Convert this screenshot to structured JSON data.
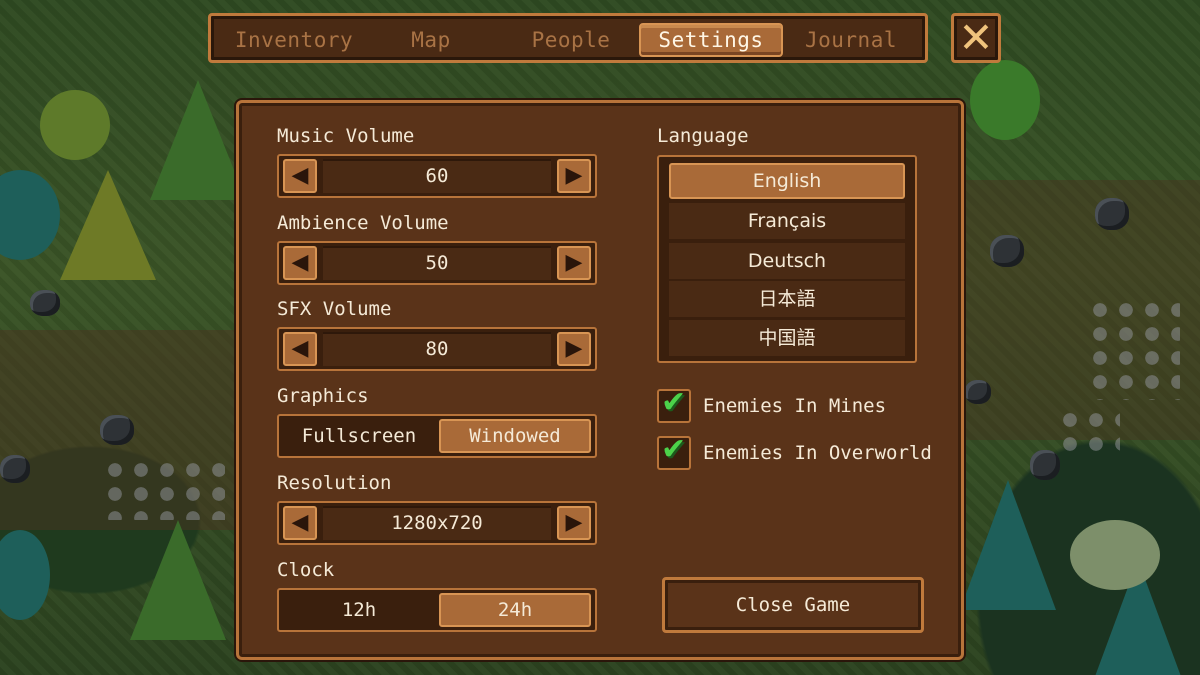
{
  "tabs": [
    {
      "label": "Inventory"
    },
    {
      "label": "Map"
    },
    {
      "label": "People"
    },
    {
      "label": "Settings",
      "active": true
    },
    {
      "label": "Journal"
    }
  ],
  "close_icon": "close-x-icon",
  "settings": {
    "music": {
      "label": "Music Volume",
      "value": "60"
    },
    "ambience": {
      "label": "Ambience Volume",
      "value": "50"
    },
    "sfx": {
      "label": "SFX Volume",
      "value": "80"
    },
    "graphics": {
      "label": "Graphics",
      "options": [
        "Fullscreen",
        "Windowed"
      ],
      "selected": "Windowed"
    },
    "resolution": {
      "label": "Resolution",
      "value": "1280x720"
    },
    "clock": {
      "label": "Clock",
      "options": [
        "12h",
        "24h"
      ],
      "selected": "24h"
    },
    "language": {
      "label": "Language",
      "options": [
        "English",
        "Français",
        "Deutsch",
        "日本語",
        "中国語"
      ],
      "selected": "English"
    },
    "enemies_mines": {
      "label": "Enemies In Mines",
      "checked": true
    },
    "enemies_overworld": {
      "label": "Enemies In Overworld",
      "checked": true
    },
    "close_game": "Close Game"
  },
  "colors": {
    "panel": "#5a3319",
    "border": "#b8743a",
    "selected": "#a96a38",
    "check": "#4cd24a"
  }
}
